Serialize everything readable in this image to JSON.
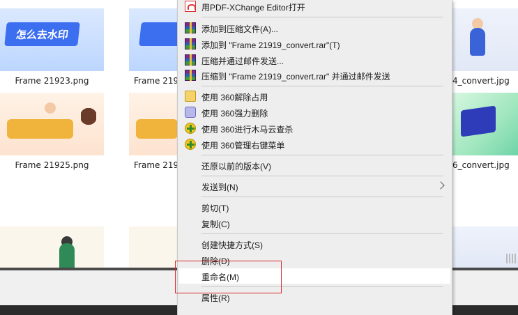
{
  "files": [
    {
      "name": "Frame 21923.png",
      "banner_text": "怎么去水印"
    },
    {
      "name": "Frame 219"
    },
    {
      "name": "4_convert.jpg"
    },
    {
      "name": "Frame 21925.png"
    },
    {
      "name": "Frame 219"
    },
    {
      "name": "6_convert.jpg"
    }
  ],
  "context_menu": {
    "items": [
      {
        "label": "用PDF-XChange Editor打开",
        "icon": "pdf-xchange-icon"
      },
      {
        "label": "添加到压缩文件(A)...",
        "icon": "winrar-icon"
      },
      {
        "label": "添加到 \"Frame 21919_convert.rar\"(T)",
        "icon": "winrar-icon"
      },
      {
        "label": "压缩并通过邮件发送...",
        "icon": "winrar-icon"
      },
      {
        "label": "压缩到 \"Frame 21919_convert.rar\" 并通过邮件发送",
        "icon": "winrar-icon"
      },
      {
        "label": "使用 360解除占用",
        "icon": "unlock-icon"
      },
      {
        "label": "使用 360强力删除",
        "icon": "shred-icon"
      },
      {
        "label": "使用 360进行木马云查杀",
        "icon": "360-icon"
      },
      {
        "label": "使用 360管理右键菜单",
        "icon": "360-icon"
      },
      {
        "label": "还原以前的版本(V)"
      },
      {
        "label": "发送到(N)",
        "has_submenu": true
      },
      {
        "label": "剪切(T)"
      },
      {
        "label": "复制(C)"
      },
      {
        "label": "创建快捷方式(S)"
      },
      {
        "label": "删除(D)"
      },
      {
        "label": "重命名(M)",
        "highlighted": true
      },
      {
        "label": "属性(R)"
      }
    ]
  },
  "colors": {
    "menu_bg": "#eeeeee",
    "hover_bg": "#ffffff",
    "annotation_red": "#d9262c"
  }
}
